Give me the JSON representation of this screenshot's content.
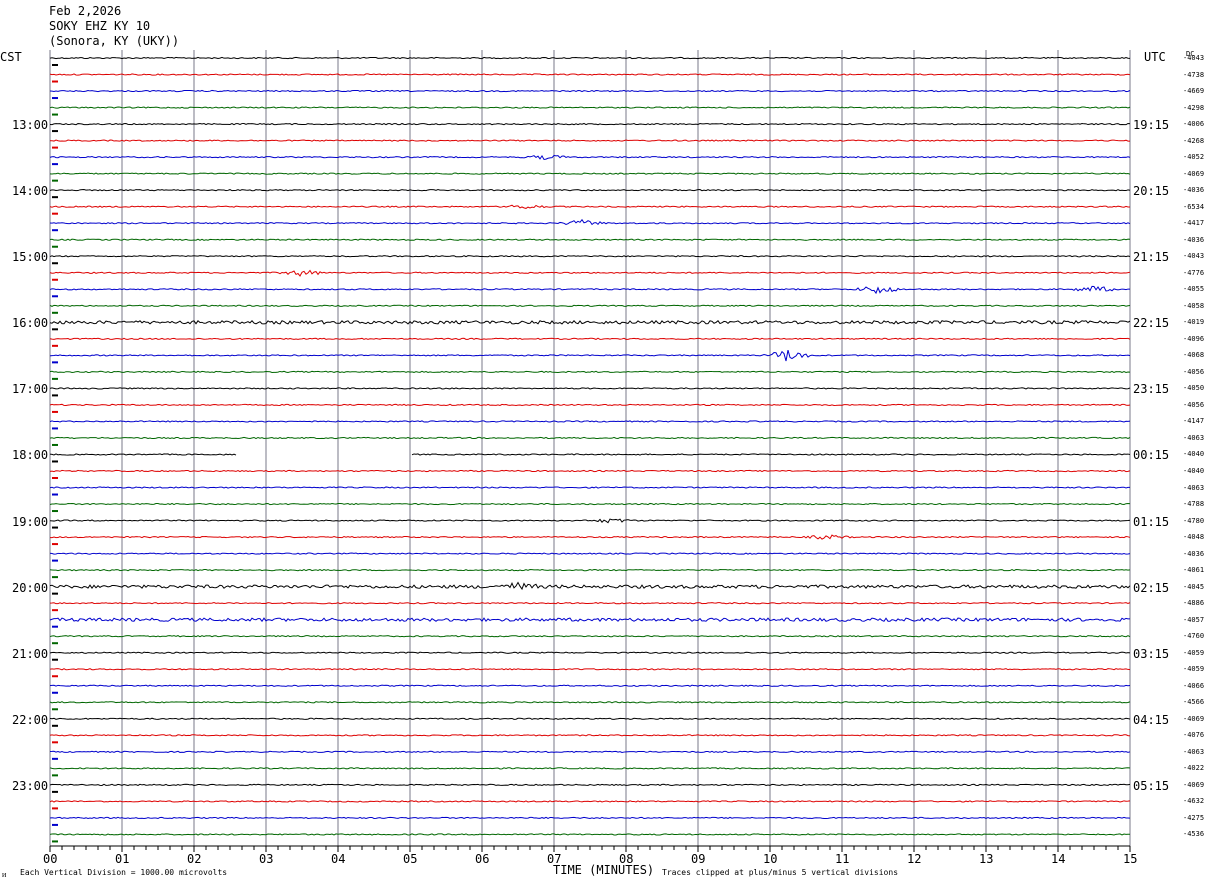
{
  "header": {
    "date": "Feb 2,2026",
    "station": "SOKY EHZ KY 10",
    "location": "(Sonora, KY (UKY))"
  },
  "left_axis_label": "CST",
  "right_axis_label": "UTC",
  "dc_label": "DC",
  "x_axis_title": "TIME (MINUTES)",
  "footer": {
    "scale_note": "Each Vertical Division = 1000.00 microvolts",
    "clip_note": "Traces clipped at plus/minus 5 vertical divisions"
  },
  "colors": {
    "trace_cycle": [
      "#000000",
      "#dd0000",
      "#0000cc",
      "#006600"
    ],
    "grid": "#7a7a8a"
  },
  "chart_data": {
    "type": "line",
    "title": "SOKY EHZ KY 10",
    "xlabel": "TIME (MINUTES)",
    "x_ticks": [
      "00",
      "01",
      "02",
      "03",
      "04",
      "05",
      "06",
      "07",
      "08",
      "09",
      "10",
      "11",
      "12",
      "13",
      "14",
      "15"
    ],
    "xlim": [
      0,
      15
    ],
    "trace_count": 48,
    "cst_hour_labels": [
      "13:00",
      "14:00",
      "15:00",
      "16:00",
      "17:00",
      "18:00",
      "19:00",
      "20:00",
      "21:00",
      "22:00",
      "23:00"
    ],
    "utc_hour_labels": [
      "19:15",
      "20:15",
      "21:15",
      "22:15",
      "23:15",
      "00:15",
      "01:15",
      "02:15",
      "03:15",
      "04:15",
      "05:15"
    ],
    "dc_offsets": [
      "-4043",
      "-4738",
      "-4669",
      "-4298",
      "-4006",
      "-4268",
      "-4052",
      "-4069",
      "-4036",
      "-6534",
      "-4417",
      "-4036",
      "-4043",
      "-4776",
      "-4055",
      "-4058",
      "-4019",
      "-4096",
      "-4068",
      "-4056",
      "-4050",
      "-4056",
      "-4147",
      "-4063",
      "-4040",
      "-4040",
      "-4063",
      "-4788",
      "-4780",
      "-4048",
      "-4036",
      "-4061",
      "-4045",
      "-4886",
      "-4057",
      "-4760",
      "-4059",
      "-4059",
      "-4066",
      "-4566",
      "-4069",
      "-4076",
      "-4063",
      "-4022",
      "-4069",
      "-4632",
      "-4275",
      "-4536"
    ],
    "gap": {
      "trace_index": 24,
      "start_minute": 2.6,
      "end_minute": 5.0
    },
    "events": [
      {
        "trace_index": 6,
        "minute": 6.9,
        "amplitude": 2
      },
      {
        "trace_index": 9,
        "minute": 6.6,
        "amplitude": 2
      },
      {
        "trace_index": 10,
        "minute": 7.4,
        "amplitude": 3
      },
      {
        "trace_index": 13,
        "minute": 3.5,
        "amplitude": 3
      },
      {
        "trace_index": 14,
        "minute": 11.5,
        "amplitude": 4
      },
      {
        "trace_index": 14,
        "minute": 14.5,
        "amplitude": 3
      },
      {
        "trace_index": 18,
        "minute": 10.25,
        "amplitude": 6
      },
      {
        "trace_index": 29,
        "minute": 10.8,
        "amplitude": 2
      },
      {
        "trace_index": 28,
        "minute": 7.8,
        "amplitude": 2
      },
      {
        "trace_index": 32,
        "minute": 6.5,
        "amplitude": 3
      }
    ],
    "noisy_traces": [
      16,
      32,
      34
    ]
  }
}
